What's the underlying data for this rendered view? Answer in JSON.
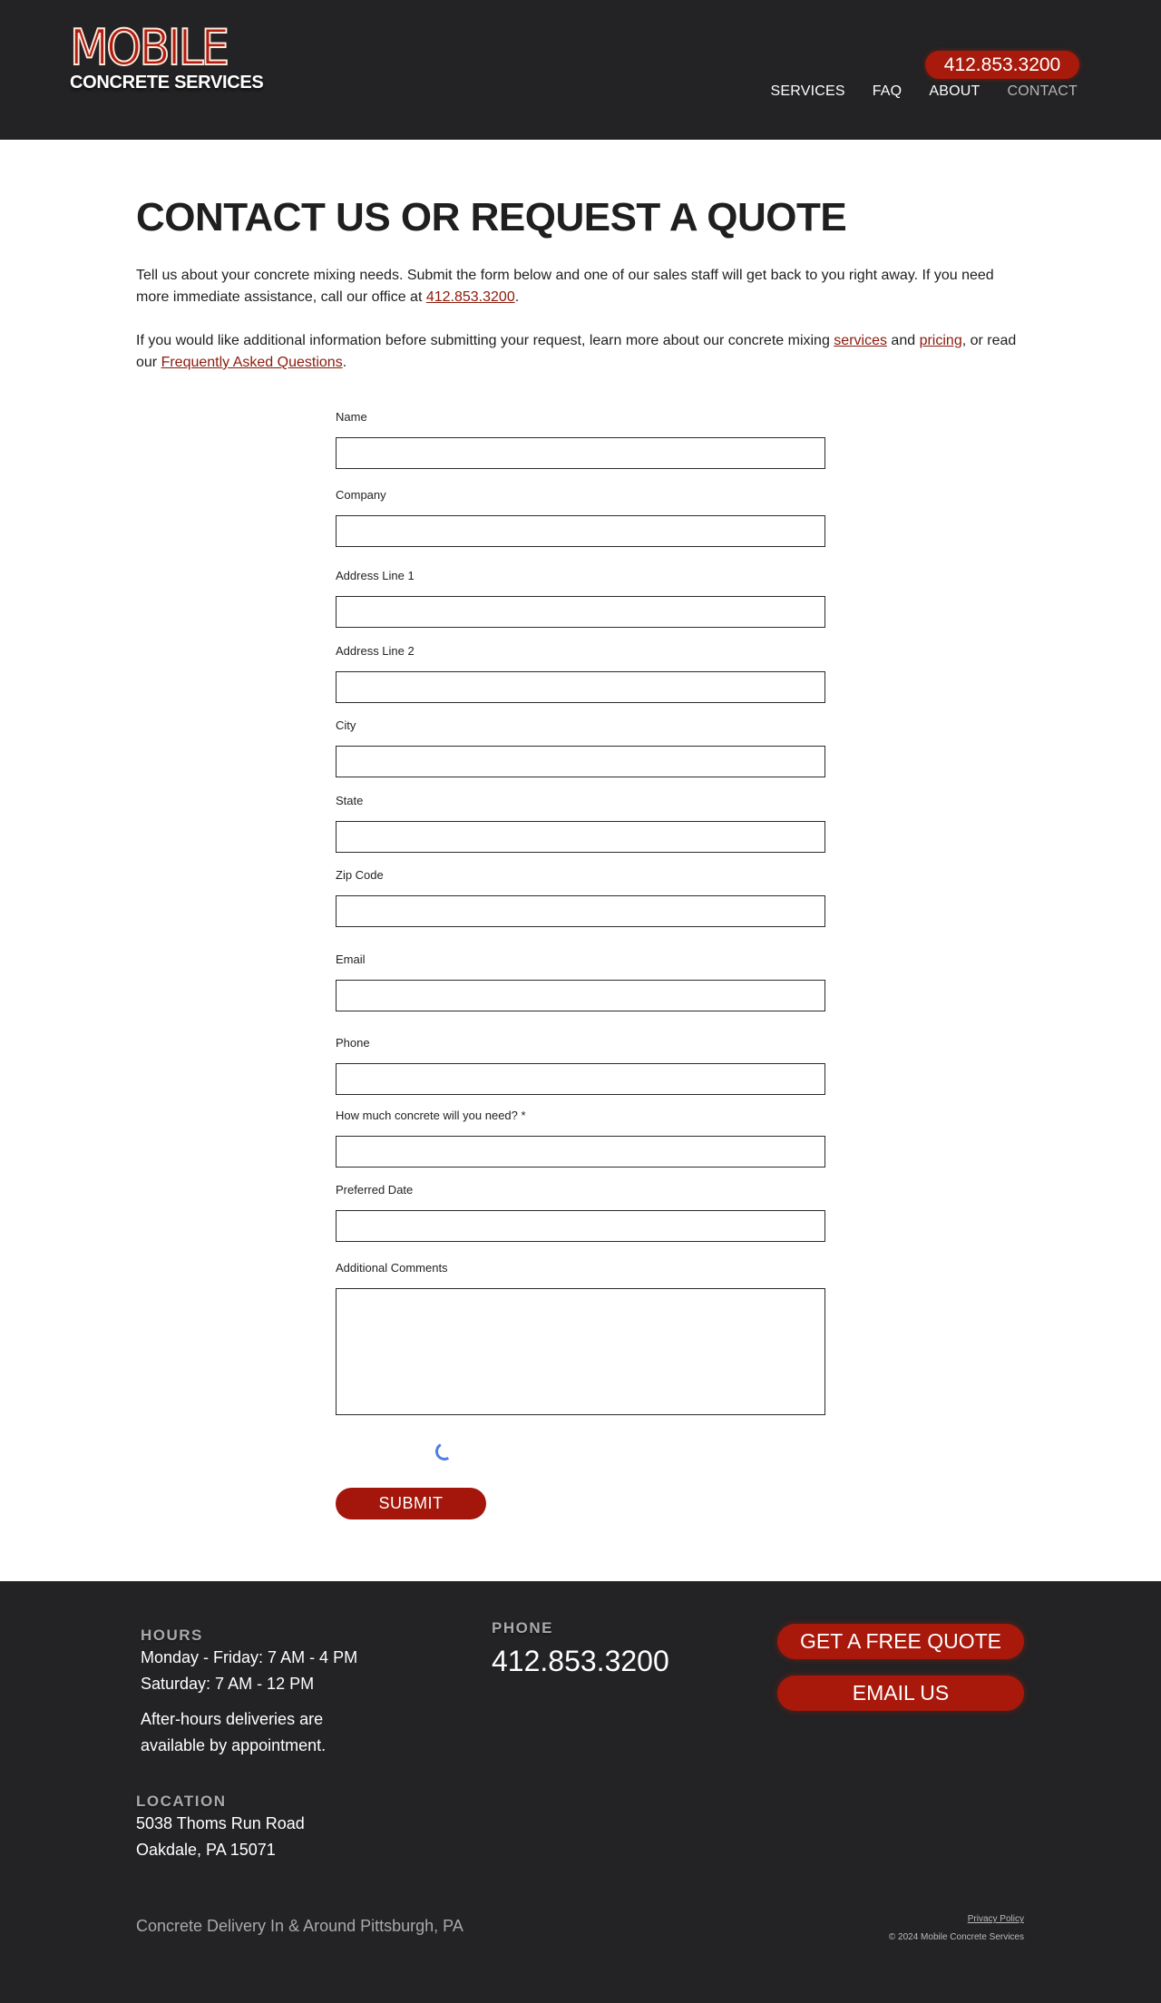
{
  "header": {
    "logo_main": "MOBILE",
    "logo_sub": "CONCRETE SERVICES",
    "phone": "412.853.3200",
    "nav": [
      {
        "label": "SERVICES",
        "active": false
      },
      {
        "label": "FAQ",
        "active": false
      },
      {
        "label": "ABOUT",
        "active": false
      },
      {
        "label": "CONTACT",
        "active": true
      }
    ]
  },
  "main": {
    "title": "CONTACT US OR REQUEST A QUOTE",
    "intro1": {
      "text": "Tell us about your concrete mixing needs. Submit the form below and one of our sales staff will get back to you right away. If you need more immediate assistance, call our office at ",
      "phone_link": "412.853.3200",
      "end": "."
    },
    "intro2": {
      "text": "If you would like additional information before submitting your request, learn more about our concrete mixing ",
      "services_link": "services",
      "and": " and ",
      "pricing_link": "pricing",
      "mid": ", or read our ",
      "faq_link": "Frequently Asked Questions",
      "end": "."
    }
  },
  "form": {
    "fields": [
      {
        "label": "Name",
        "value": ""
      },
      {
        "label": "Company",
        "value": ""
      },
      {
        "label": "Address Line 1",
        "value": ""
      },
      {
        "label": "Address Line 2",
        "value": ""
      },
      {
        "label": "City",
        "value": ""
      },
      {
        "label": "State",
        "value": ""
      },
      {
        "label": "Zip Code",
        "value": ""
      },
      {
        "label": "Email",
        "value": ""
      },
      {
        "label": "Phone",
        "value": ""
      },
      {
        "label": "How much concrete will you need? *",
        "value": ""
      },
      {
        "label": "Preferred Date",
        "value": ""
      }
    ],
    "comments_label": "Additional Comments",
    "comments_value": "",
    "submit_label": "SUBMIT"
  },
  "footer": {
    "hours_label": "HOURS",
    "hours_weekday": "Monday - Friday: 7 AM - 4 PM",
    "hours_saturday": "Saturday: 7 AM - 12 PM",
    "after_hours": "After-hours deliveries are available by appointment.",
    "phone_label": "PHONE",
    "phone": "412.853.3200",
    "quote_button": "GET A FREE QUOTE",
    "email_button": "EMAIL US",
    "location_label": "LOCATION",
    "address1": "5038 Thoms Run Road",
    "address2": "Oakdale, PA 15071",
    "tagline": "Concrete Delivery In & Around Pittsburgh, PA",
    "privacy": "Privacy Policy",
    "copyright": "© 2024 Mobile Concrete Services"
  },
  "colors": {
    "brand_red": "#a8180b",
    "header_bg": "#232224",
    "link_red": "#8c1a0b"
  }
}
